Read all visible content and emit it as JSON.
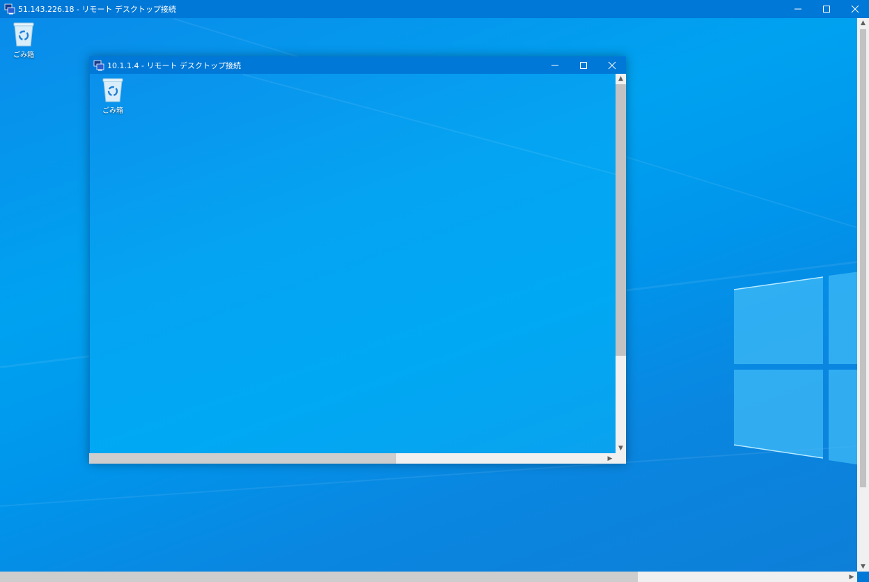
{
  "outer_window": {
    "title": "51.143.226.18  - リモート デスクトップ接続",
    "controls": [
      "minimize-icon",
      "maximize-icon",
      "close-icon"
    ]
  },
  "outer_desktop": {
    "icons": [
      {
        "label": "ごみ箱",
        "icon": "recycle-bin-icon"
      }
    ]
  },
  "inner_window": {
    "title": "10.1.1.4  - リモート デスクトップ接続",
    "controls": [
      "minimize-icon",
      "maximize-icon",
      "close-icon"
    ]
  },
  "inner_desktop": {
    "icons": [
      {
        "label": "ごみ箱",
        "icon": "recycle-bin-icon"
      }
    ]
  },
  "colors": {
    "titlebar": "#0078d7",
    "desktop_blue": "#00a2f0",
    "scrollbar_track": "#f0f0f0",
    "scrollbar_thumb": "#c2c2c2"
  }
}
